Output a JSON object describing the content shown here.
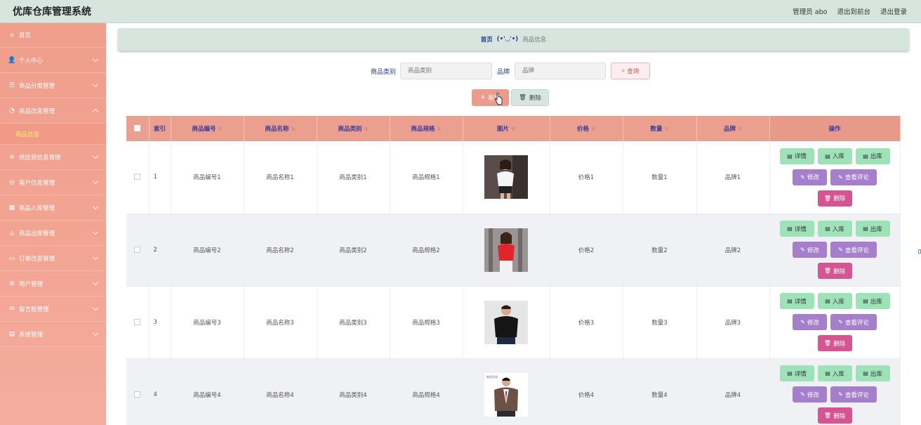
{
  "app": {
    "title": "优库仓库管理系统",
    "admin_label": "管理员 abo",
    "front_link": "退出到前台",
    "logout_link": "退出登录"
  },
  "sidebar": {
    "items": [
      {
        "label": "首页",
        "icon": "home-icon",
        "glyph": "⌂",
        "chevron": "none"
      },
      {
        "label": "个人中心",
        "icon": "user-icon",
        "glyph": "👤",
        "chevron": "down"
      },
      {
        "label": "商品分类管理",
        "icon": "sliders-icon",
        "glyph": "☰",
        "chevron": "down"
      },
      {
        "label": "商品信息管理",
        "icon": "dashboard-icon",
        "glyph": "◔",
        "chevron": "up",
        "submenu": [
          "商品信息"
        ]
      },
      {
        "label": "供应商信息管理",
        "icon": "list-icon",
        "glyph": "≡",
        "chevron": "down"
      },
      {
        "label": "客户信息管理",
        "icon": "target-icon",
        "glyph": "◎",
        "chevron": "down"
      },
      {
        "label": "商品入库管理",
        "icon": "grid-icon",
        "glyph": "▦",
        "chevron": "down"
      },
      {
        "label": "商品出库管理",
        "icon": "chart-icon",
        "glyph": "◬",
        "chevron": "down"
      },
      {
        "label": "订单信息管理",
        "icon": "monitor-icon",
        "glyph": "▭",
        "chevron": "down"
      },
      {
        "label": "用户管理",
        "icon": "close-circle-icon",
        "glyph": "⊗",
        "chevron": "down"
      },
      {
        "label": "留言板管理",
        "icon": "mail-icon",
        "glyph": "✉",
        "chevron": "down"
      },
      {
        "label": "系统管理",
        "icon": "card-icon",
        "glyph": "▤",
        "chevron": "down"
      }
    ]
  },
  "breadcrumb": {
    "home": "首页",
    "separator": "(•'◡'•)",
    "current": "商品信息"
  },
  "search": {
    "category_label": "商品类别",
    "category_placeholder": "商品类别",
    "brand_label": "品牌",
    "brand_placeholder": "品牌",
    "button": "查询"
  },
  "actions": {
    "add": "新增",
    "delete": "删除"
  },
  "table": {
    "headers": [
      "索引",
      "商品编号",
      "商品名称",
      "商品类别",
      "商品规格",
      "图片",
      "价格",
      "数量",
      "品牌",
      "操作"
    ],
    "rows": [
      {
        "index": "1",
        "code": "商品编号1",
        "name": "商品名称1",
        "category": "商品类别1",
        "spec": "商品规格1",
        "image": "white-top-model",
        "price": "价格1",
        "qty": "数量1",
        "brand": "品牌1"
      },
      {
        "index": "2",
        "code": "商品编号2",
        "name": "商品名称2",
        "category": "商品类别2",
        "spec": "商品规格2",
        "image": "red-top-model",
        "price": "价格2",
        "qty": "数量2",
        "brand": "品牌2"
      },
      {
        "index": "3",
        "code": "商品编号3",
        "name": "商品名称3",
        "category": "商品类别3",
        "spec": "商品规格3",
        "image": "black-tshirt-man",
        "price": "价格3",
        "qty": "数量3",
        "brand": "品牌3"
      },
      {
        "index": "4",
        "code": "商品编号4",
        "name": "商品名称4",
        "category": "商品类别4",
        "spec": "商品规格4",
        "image": "suit-jacket-man",
        "price": "价格4",
        "qty": "数量4",
        "brand": "品牌4"
      }
    ],
    "row_actions": {
      "detail": "详情",
      "stock_in": "入库",
      "stock_out": "出库",
      "edit": "修改",
      "reviews": "查看评论",
      "delete": "删除"
    }
  },
  "colors": {
    "header_bg": "#d6e6de",
    "sidebar_bg": "#f09e8c",
    "table_head": "#ea9f8f",
    "btn_green": "#9ee2b8",
    "btn_purple": "#a67fcc",
    "btn_pink": "#d45592"
  }
}
